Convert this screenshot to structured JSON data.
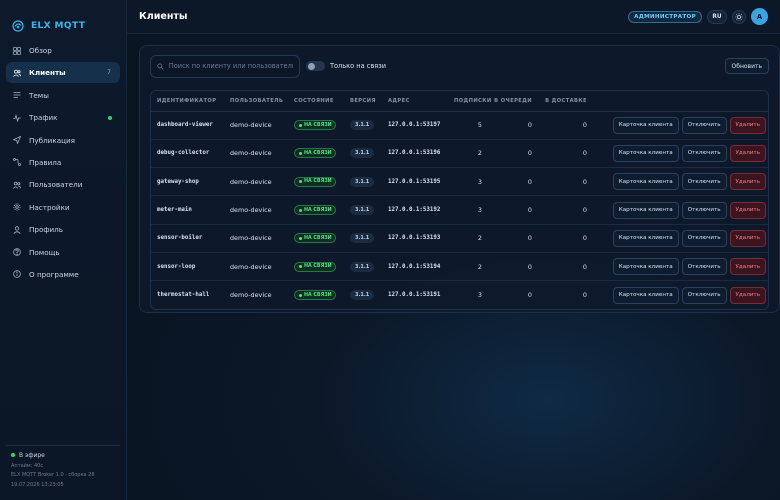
{
  "brand": {
    "name": "ELX MQTT"
  },
  "sidebar": {
    "items": [
      {
        "label": "Обзор",
        "icon": "grid-icon"
      },
      {
        "label": "Клиенты",
        "icon": "users-icon",
        "badge": "7",
        "active": true
      },
      {
        "label": "Темы",
        "icon": "list-icon"
      },
      {
        "label": "Трафик",
        "icon": "pulse-icon",
        "indicator": true
      },
      {
        "label": "Публикация",
        "icon": "send-icon"
      },
      {
        "label": "Правила",
        "icon": "flow-icon"
      },
      {
        "label": "Пользователи",
        "icon": "user-group-icon"
      },
      {
        "label": "Настройки",
        "icon": "gear-icon"
      },
      {
        "label": "Профиль",
        "icon": "person-icon"
      },
      {
        "label": "Помощь",
        "icon": "help-icon"
      },
      {
        "label": "О программе",
        "icon": "info-icon"
      }
    ],
    "footer": {
      "status": "В эфире",
      "uptime": "Аптайм: 40с",
      "version": "ELX MQTT Broker 1.0 · сборка 28",
      "timestamp": "19.07.2026 13:23:05"
    }
  },
  "header": {
    "title": "Клиенты",
    "role": "АДМИНИСТРАТОР",
    "lang": "RU",
    "avatar": "A"
  },
  "filters": {
    "search_placeholder": "Поиск по клиенту или пользователю",
    "search_value": "",
    "online_only_label": "Только на связи",
    "online_only": false,
    "refresh_label": "Обновить"
  },
  "table": {
    "columns": [
      "ИДЕНТИФИКАТОР",
      "ПОЛЬЗОВАТЕЛЬ",
      "СОСТОЯНИЕ",
      "ВЕРСИЯ",
      "АДРЕС",
      "ПОДПИСКИ",
      "В ОЧЕРЕДИ",
      "В ДОСТАВКЕ"
    ],
    "actions": {
      "card": "Карточка клиента",
      "disconnect": "Отключить",
      "delete": "Удалить"
    },
    "status_online": "НА СВЯЗИ",
    "rows": [
      {
        "id": "dashboard-viewer",
        "user": "demo-device",
        "version": "3.1.1",
        "address": "127.0.0.1:53197",
        "subs": "5",
        "queued": "0",
        "inflight": "0"
      },
      {
        "id": "debug-collector",
        "user": "demo-device",
        "version": "3.1.1",
        "address": "127.0.0.1:53196",
        "subs": "2",
        "queued": "0",
        "inflight": "0"
      },
      {
        "id": "gateway-shop",
        "user": "demo-device",
        "version": "3.1.1",
        "address": "127.0.0.1:53195",
        "subs": "3",
        "queued": "0",
        "inflight": "0"
      },
      {
        "id": "meter-main",
        "user": "demo-device",
        "version": "3.1.1",
        "address": "127.0.0.1:53192",
        "subs": "3",
        "queued": "0",
        "inflight": "0"
      },
      {
        "id": "sensor-boiler",
        "user": "demo-device",
        "version": "3.1.1",
        "address": "127.0.0.1:53193",
        "subs": "2",
        "queued": "0",
        "inflight": "0"
      },
      {
        "id": "sensor-loop",
        "user": "demo-device",
        "version": "3.1.1",
        "address": "127.0.0.1:53194",
        "subs": "2",
        "queued": "0",
        "inflight": "0"
      },
      {
        "id": "thermostat-hall",
        "user": "demo-device",
        "version": "3.1.1",
        "address": "127.0.0.1:53191",
        "subs": "3",
        "queued": "0",
        "inflight": "0"
      }
    ]
  },
  "colors": {
    "accent": "#38b6e8",
    "online": "#4ee07f",
    "danger": "#ff7b85"
  }
}
